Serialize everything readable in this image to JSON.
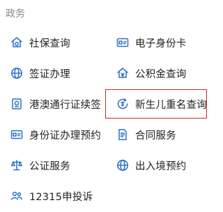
{
  "section": {
    "title": "政务"
  },
  "items": [
    {
      "label": "社保查询",
      "icon": "house-shield-icon"
    },
    {
      "label": "电子身份卡",
      "icon": "id-card-icon"
    },
    {
      "label": "签证办理",
      "icon": "globe-icon"
    },
    {
      "label": "公积金查询",
      "icon": "house-money-icon"
    },
    {
      "label": "港澳通行证续签",
      "icon": "passport-icon"
    },
    {
      "label": "新生儿重名查询",
      "icon": "name-search-icon"
    },
    {
      "label": "身份证办理预约",
      "icon": "id-card-icon"
    },
    {
      "label": "合同服务",
      "icon": "contract-icon"
    },
    {
      "label": "公证服务",
      "icon": "scales-icon"
    },
    {
      "label": "出入境预约",
      "icon": "globe-icon"
    },
    {
      "label": "12315申投诉",
      "icon": "people-icon"
    }
  ],
  "colors": {
    "icon": "#2b6fc9",
    "highlight": "#c8292f",
    "section_title": "#8a8a8a",
    "text": "#222222"
  }
}
